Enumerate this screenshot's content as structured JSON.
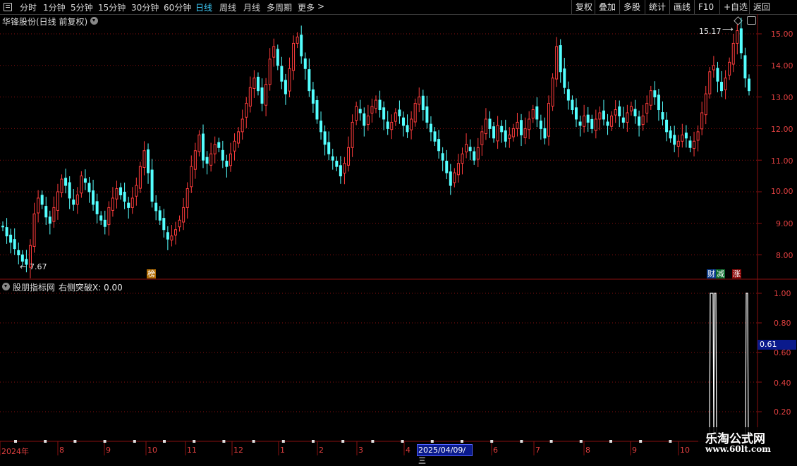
{
  "toolbar": {
    "menu_icon": "menu-icon",
    "periods": [
      "分时",
      "1分钟",
      "5分钟",
      "15分钟",
      "30分钟",
      "60分钟",
      "日线",
      "周线",
      "月线",
      "多周期",
      "更多"
    ],
    "active_period": "日线",
    "more_arrow": ">",
    "right_buttons": [
      "复权",
      "叠加",
      "多股",
      "统计",
      "画线",
      "F10",
      "+自选",
      "返回"
    ]
  },
  "main_chart": {
    "title": "华锋股份(日线 前复权)",
    "price_axis": [
      "15.00",
      "14.00",
      "13.00",
      "12.00",
      "11.00",
      "10.00",
      "9.00",
      "8.00"
    ],
    "high_marker": "15.17",
    "low_marker": "7.67",
    "badges": [
      "榜",
      "财",
      "减",
      "涨"
    ]
  },
  "indicator": {
    "title": "股朋指标网",
    "series_label": "右侧突破X: 0.00",
    "axis": [
      "1.00",
      "0.80",
      "0.60",
      "0.40",
      "0.20"
    ],
    "cursor_value": "0.61"
  },
  "time_axis": {
    "labels": [
      "2024年",
      "8",
      "9",
      "10",
      "11",
      "12",
      "1",
      "2",
      "3",
      "4",
      "6",
      "7",
      "8",
      "9",
      "10"
    ],
    "cursor_date": "2025/04/09/三"
  },
  "watermark": {
    "name": "乐淘公式网",
    "url": "www.60lt.com"
  },
  "colors": {
    "up": "#ff3c3c",
    "down": "#54ffff",
    "grid": "#8a1010",
    "active": "#3fd0ff"
  },
  "chart_data": {
    "type": "candlestick",
    "ylim": [
      7.6,
      15.3
    ],
    "x_start": "2024年",
    "close_approx": [
      8.9,
      8.6,
      8.4,
      8.2,
      8.0,
      7.8,
      7.7,
      8.3,
      9.3,
      9.8,
      9.6,
      9.2,
      9.0,
      9.5,
      10.0,
      10.4,
      10.2,
      9.8,
      9.6,
      9.9,
      10.5,
      10.3,
      10.0,
      9.6,
      9.3,
      9.1,
      8.9,
      9.5,
      9.8,
      10.1,
      9.9,
      9.7,
      9.5,
      9.8,
      10.2,
      10.8,
      11.3,
      10.6,
      9.7,
      9.4,
      9.1,
      8.8,
      8.5,
      8.6,
      8.8,
      9.1,
      9.5,
      10.1,
      10.8,
      11.3,
      11.8,
      11.0,
      10.9,
      11.2,
      11.5,
      11.4,
      11.0,
      10.8,
      11.2,
      11.6,
      11.9,
      12.3,
      12.8,
      13.3,
      13.6,
      13.2,
      12.8,
      13.4,
      14.2,
      14.6,
      14.0,
      13.5,
      13.1,
      13.9,
      14.7,
      14.9,
      14.3,
      13.9,
      13.2,
      12.8,
      12.3,
      11.9,
      11.5,
      11.2,
      11.0,
      10.8,
      10.5,
      10.9,
      11.4,
      12.2,
      12.7,
      12.5,
      12.1,
      12.4,
      12.7,
      12.9,
      12.6,
      12.3,
      12.0,
      12.2,
      12.5,
      12.4,
      12.1,
      11.9,
      12.3,
      12.8,
      13.0,
      12.6,
      12.2,
      11.9,
      11.6,
      11.3,
      11.0,
      10.6,
      10.2,
      10.6,
      10.9,
      11.2,
      11.5,
      11.3,
      11.0,
      11.4,
      11.9,
      12.3,
      12.0,
      11.7,
      12.1,
      11.9,
      11.6,
      11.8,
      12.0,
      12.2,
      11.8,
      12.0,
      12.3,
      12.6,
      12.3,
      12.0,
      11.7,
      12.8,
      13.6,
      14.6,
      13.8,
      13.3,
      12.9,
      12.6,
      12.3,
      12.1,
      12.4,
      12.2,
      12.0,
      12.3,
      12.5,
      12.3,
      12.1,
      12.4,
      12.6,
      12.4,
      12.2,
      12.5,
      12.7,
      12.4,
      12.1,
      12.4,
      12.8,
      13.2,
      13.0,
      12.6,
      12.3,
      11.9,
      11.7,
      11.5,
      11.6,
      11.8,
      11.7,
      11.4,
      11.6,
      11.9,
      12.5,
      13.1,
      13.8,
      14.0,
      13.5,
      13.2,
      13.6,
      14.1,
      14.7,
      15.1,
      14.4,
      13.6,
      13.2
    ]
  }
}
